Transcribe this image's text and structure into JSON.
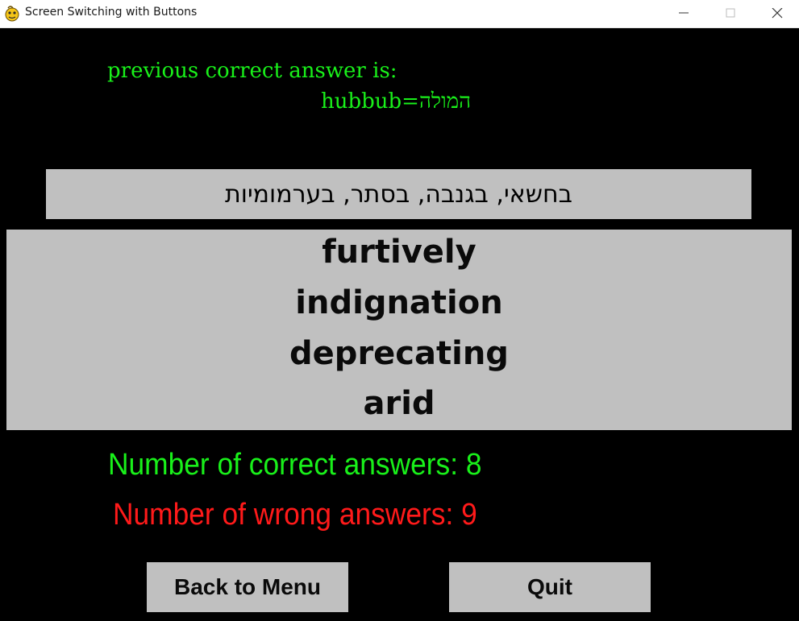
{
  "window": {
    "title": "Screen Switching with Buttons",
    "icon": "pygame-snake-icon",
    "controls": [
      "minimize-icon",
      "maximize-icon",
      "close-icon"
    ]
  },
  "previous": {
    "label": "previous correct answer is:",
    "answer": "hubbub=המולה"
  },
  "question": {
    "text": "בחשאי, בגנבה, בסתר, בערמומיות"
  },
  "options": [
    {
      "label": "furtively"
    },
    {
      "label": "indignation"
    },
    {
      "label": "deprecating"
    },
    {
      "label": "arid"
    }
  ],
  "score": {
    "correct_text": "Number of correct answers: 8",
    "wrong_text": "Number of wrong answers: 9"
  },
  "buttons": {
    "back_label": "Back to Menu",
    "quit_label": "Quit"
  },
  "colors": {
    "background": "#000000",
    "panel": "#c0c0c0",
    "correct_green": "#19f01a",
    "wrong_red": "#ff1a1a"
  }
}
